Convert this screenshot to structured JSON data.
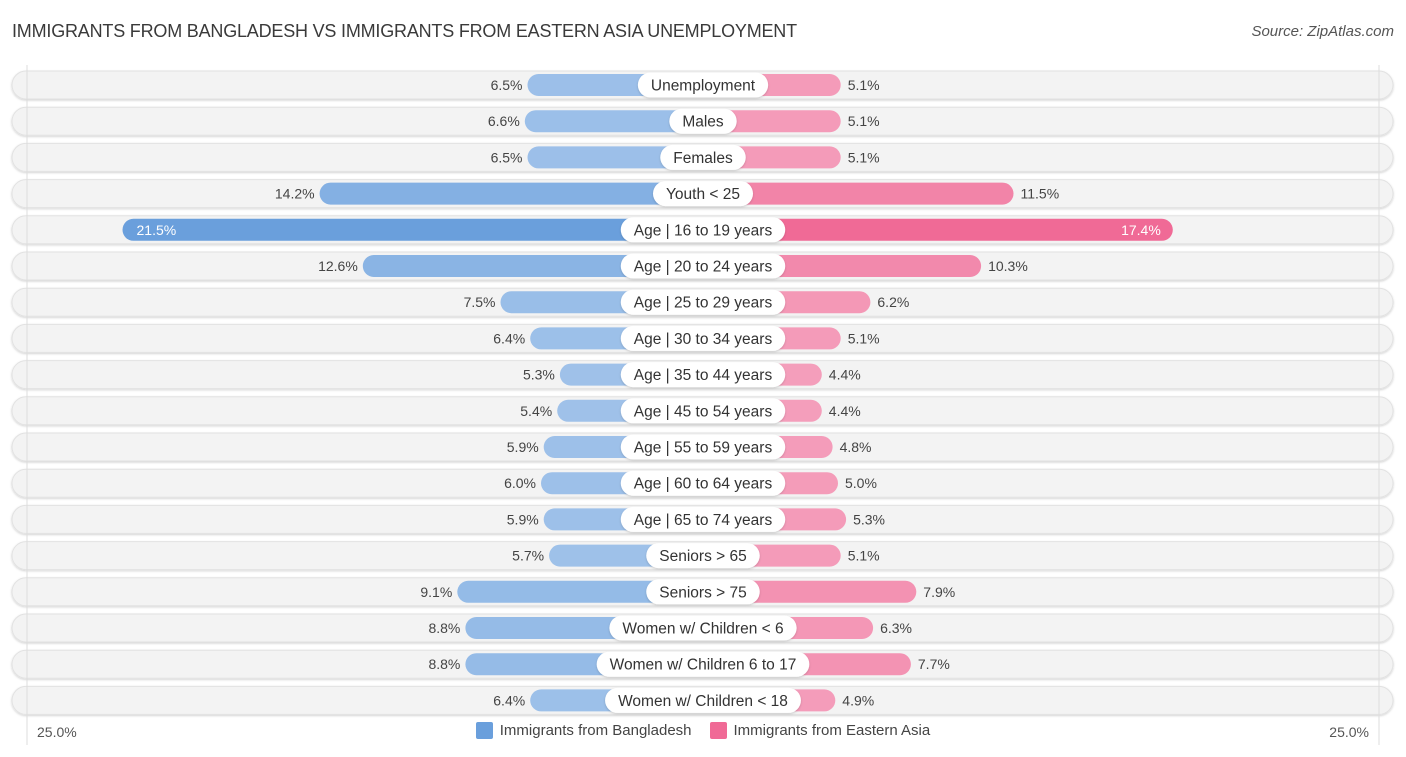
{
  "title": "IMMIGRANTS FROM BANGLADESH VS IMMIGRANTS FROM EASTERN ASIA UNEMPLOYMENT",
  "source": "Source: ZipAtlas.com",
  "colors": {
    "left_series": "#6a9fdc",
    "left_series_light": "#a9c8ec",
    "right_series": "#f06a96",
    "right_series_light": "#f5a8c2",
    "row_background": "#f2f2f2"
  },
  "chart_data": {
    "type": "bar",
    "orientation": "horizontal-diverging",
    "title": "IMMIGRANTS FROM BANGLADESH VS IMMIGRANTS FROM EASTERN ASIA UNEMPLOYMENT",
    "xlabel": "",
    "ylabel": "",
    "xlim": [
      -25.0,
      25.0
    ],
    "axis_min_label": "25.0%",
    "axis_max_label": "25.0%",
    "legend_position": "bottom-center",
    "grid": false,
    "categories": [
      "Unemployment",
      "Males",
      "Females",
      "Youth < 25",
      "Age | 16 to 19 years",
      "Age | 20 to 24 years",
      "Age | 25 to 29 years",
      "Age | 30 to 34 years",
      "Age | 35 to 44 years",
      "Age | 45 to 54 years",
      "Age | 55 to 59 years",
      "Age | 60 to 64 years",
      "Age | 65 to 74 years",
      "Seniors > 65",
      "Seniors > 75",
      "Women w/ Children < 6",
      "Women w/ Children 6 to 17",
      "Women w/ Children < 18"
    ],
    "series": [
      {
        "name": "Immigrants from Bangladesh",
        "side": "left",
        "values": [
          6.5,
          6.6,
          6.5,
          14.2,
          21.5,
          12.6,
          7.5,
          6.4,
          5.3,
          5.4,
          5.9,
          6.0,
          5.9,
          5.7,
          9.1,
          8.8,
          8.8,
          6.4
        ],
        "labels": [
          "6.5%",
          "6.6%",
          "6.5%",
          "14.2%",
          "21.5%",
          "12.6%",
          "7.5%",
          "6.4%",
          "5.3%",
          "5.4%",
          "5.9%",
          "6.0%",
          "5.9%",
          "5.7%",
          "9.1%",
          "8.8%",
          "8.8%",
          "6.4%"
        ]
      },
      {
        "name": "Immigrants from Eastern Asia",
        "side": "right",
        "values": [
          5.1,
          5.1,
          5.1,
          11.5,
          17.4,
          10.3,
          6.2,
          5.1,
          4.4,
          4.4,
          4.8,
          5.0,
          5.3,
          5.1,
          7.9,
          6.3,
          7.7,
          4.9
        ],
        "labels": [
          "5.1%",
          "5.1%",
          "5.1%",
          "11.5%",
          "17.4%",
          "10.3%",
          "6.2%",
          "5.1%",
          "4.4%",
          "4.4%",
          "4.8%",
          "5.0%",
          "5.3%",
          "5.1%",
          "7.9%",
          "6.3%",
          "7.7%",
          "4.9%"
        ]
      }
    ]
  },
  "legend": [
    {
      "label": "Immigrants from Bangladesh",
      "color": "#6a9fdc"
    },
    {
      "label": "Immigrants from Eastern Asia",
      "color": "#f06a96"
    }
  ]
}
